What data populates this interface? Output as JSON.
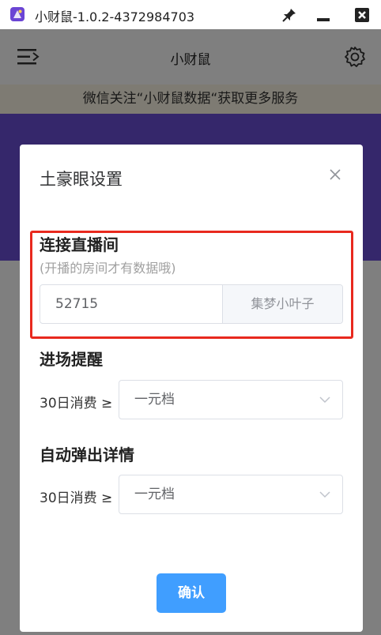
{
  "window": {
    "title": "小财鼠-1.0.2-4372984703"
  },
  "app": {
    "title": "小财鼠",
    "notice": "微信关注“小财鼠数据“获取更多服务"
  },
  "dialog": {
    "title": "土豪眼设置",
    "connect": {
      "heading": "连接直播间",
      "hint": "(开播的房间才有数据哦)",
      "room_id": "52715",
      "room_name": "集梦小叶子"
    },
    "entry_alert": {
      "heading": "进场提醒",
      "label": "30日消费 ≥",
      "selected": "一元档"
    },
    "auto_popup": {
      "heading": "自动弹出详情",
      "label": "30日消费 ≥",
      "selected": "一元档"
    },
    "confirm_label": "确认"
  },
  "colors": {
    "brand_purple": "#6a4fd6",
    "primary_blue": "#409eff",
    "highlight_red": "#e8291e",
    "notice_bg": "#fdf6e6"
  },
  "icons": {
    "app": "app-logo-icon",
    "pin": "pin-icon",
    "minimize": "minimize-icon",
    "close": "close-icon",
    "menu": "menu-icon",
    "settings": "gear-icon",
    "dialog_close": "close-icon",
    "select_arrow": "chevron-down-icon"
  }
}
